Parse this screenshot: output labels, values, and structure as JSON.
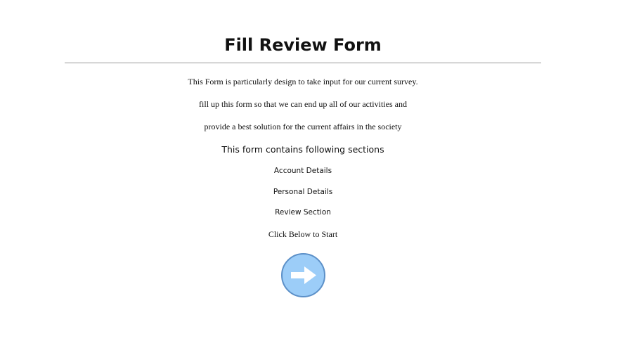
{
  "page": {
    "title": "Fill Review Form",
    "intro_lines": [
      "This Form is particularly design to take input for our current survey.",
      "fill up this form so that we can end up all of our activities and",
      "provide a best solution for the current affairs in the society"
    ],
    "sections_heading": "This form contains following sections",
    "sections": [
      "Account Details",
      "Personal Details",
      "Review Section"
    ],
    "cta_text": "Click Below to Start",
    "start_button_icon": "arrow-right-icon",
    "colors": {
      "button_fill": "#9ccdf8",
      "button_border": "#5c90c8",
      "arrow": "#ffffff"
    }
  }
}
